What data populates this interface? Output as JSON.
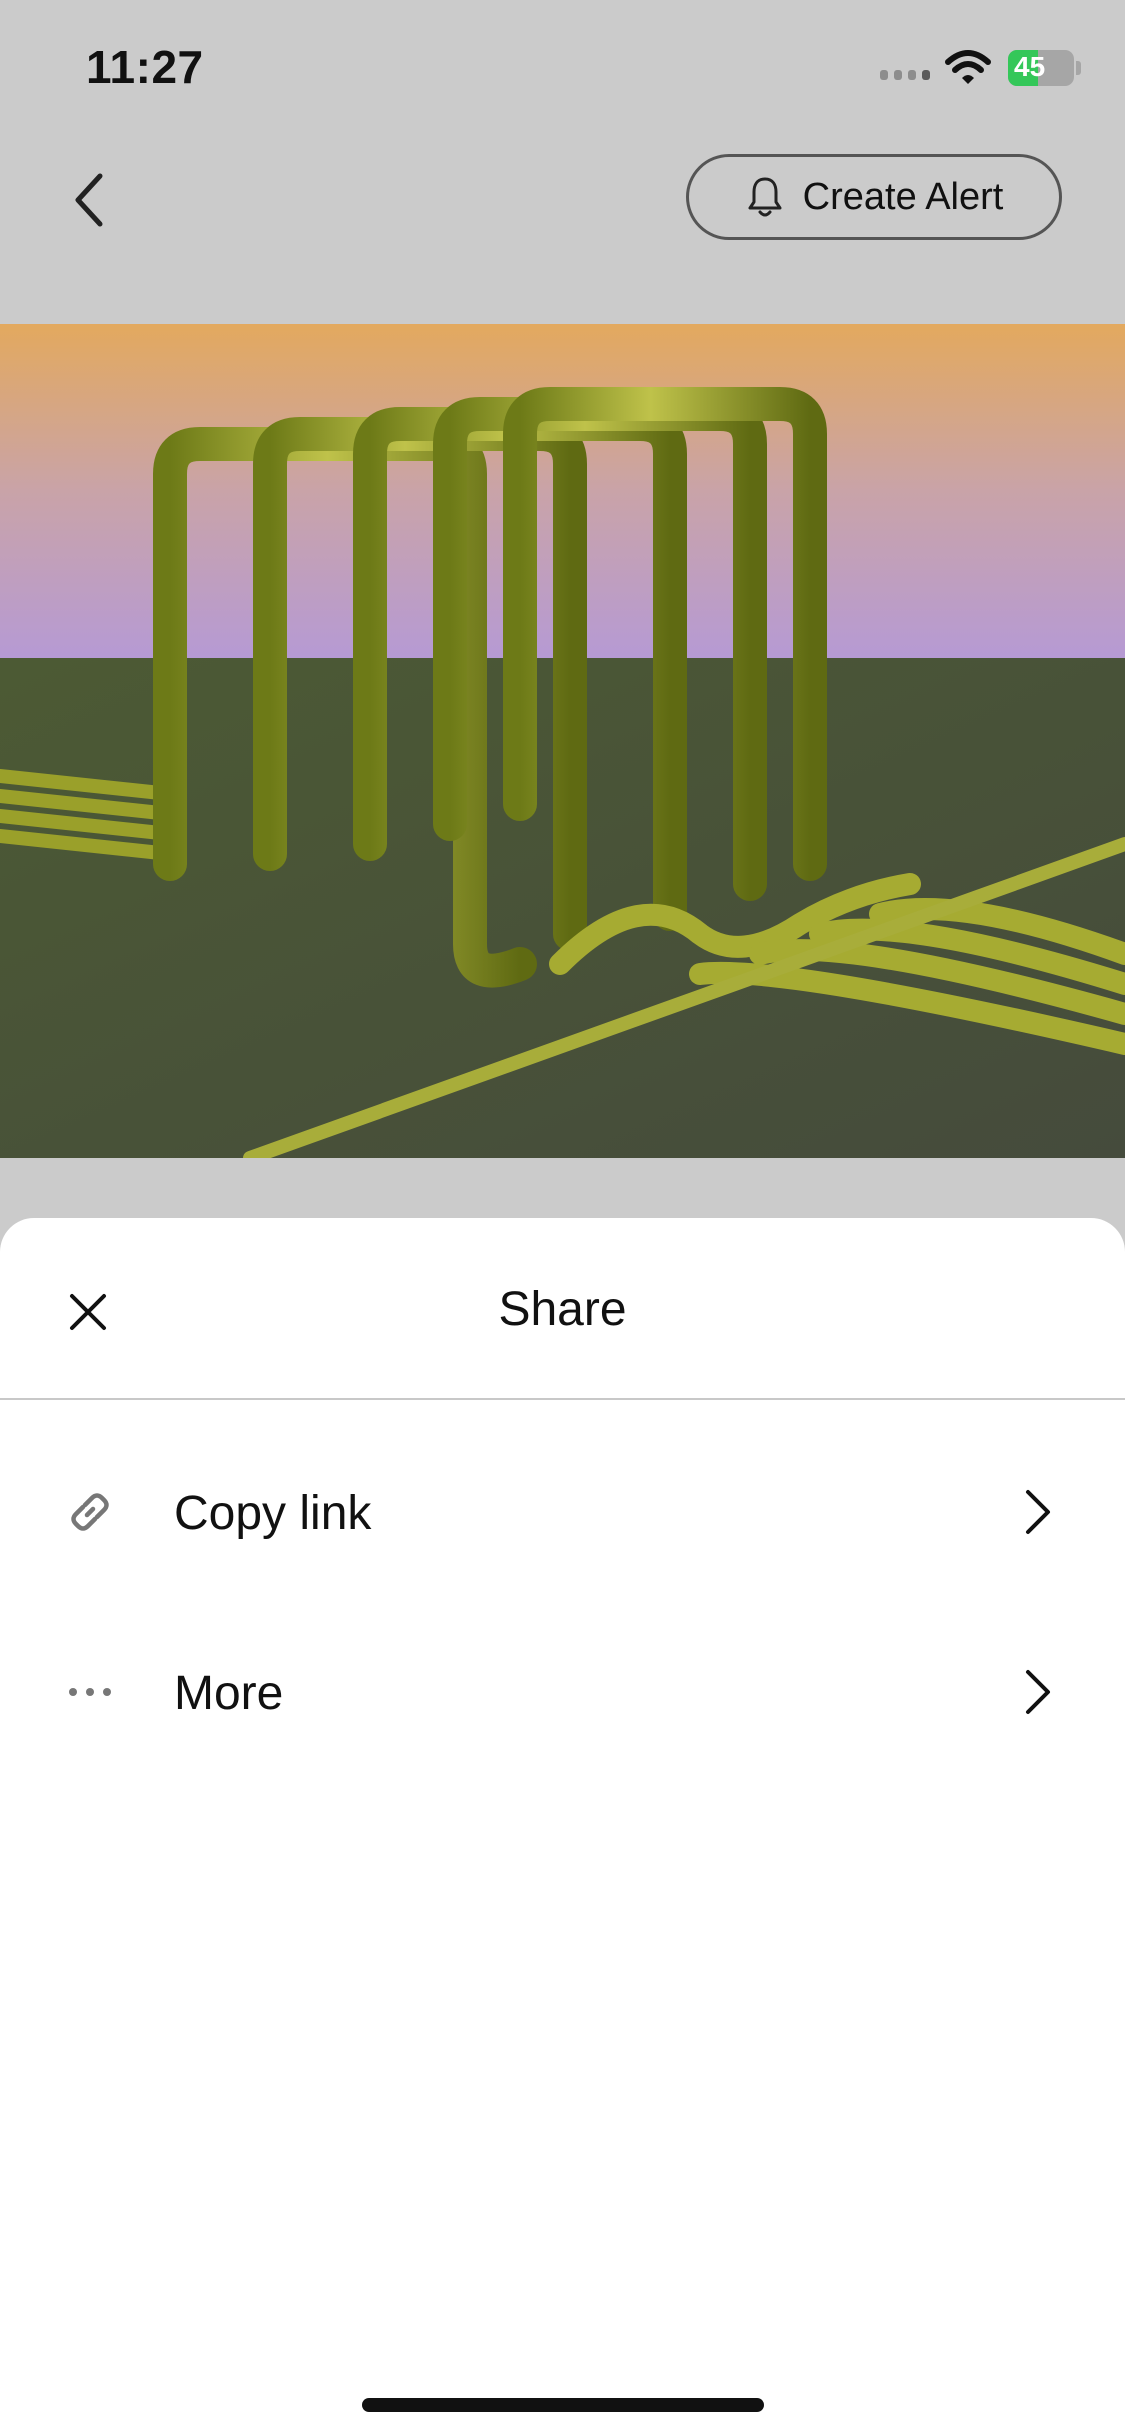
{
  "status_bar": {
    "time": "11:27",
    "battery_level": "45",
    "battery_fill_fraction": 0.45,
    "battery_color": "#34c759"
  },
  "header": {
    "back_icon": "chevron-left-icon",
    "alert_button_label": "Create Alert",
    "alert_icon": "bell-icon"
  },
  "artwork": {
    "description_icon": "artwork-image"
  },
  "share_sheet": {
    "title": "Share",
    "close_icon": "close-icon",
    "options": [
      {
        "label": "Copy link",
        "icon": "link-icon"
      },
      {
        "label": "More",
        "icon": "more-dots-icon"
      }
    ]
  },
  "colors": {
    "background_dim": "#cbcbcb",
    "sheet": "#ffffff",
    "text": "#111111",
    "divider": "#c8c8c8"
  }
}
